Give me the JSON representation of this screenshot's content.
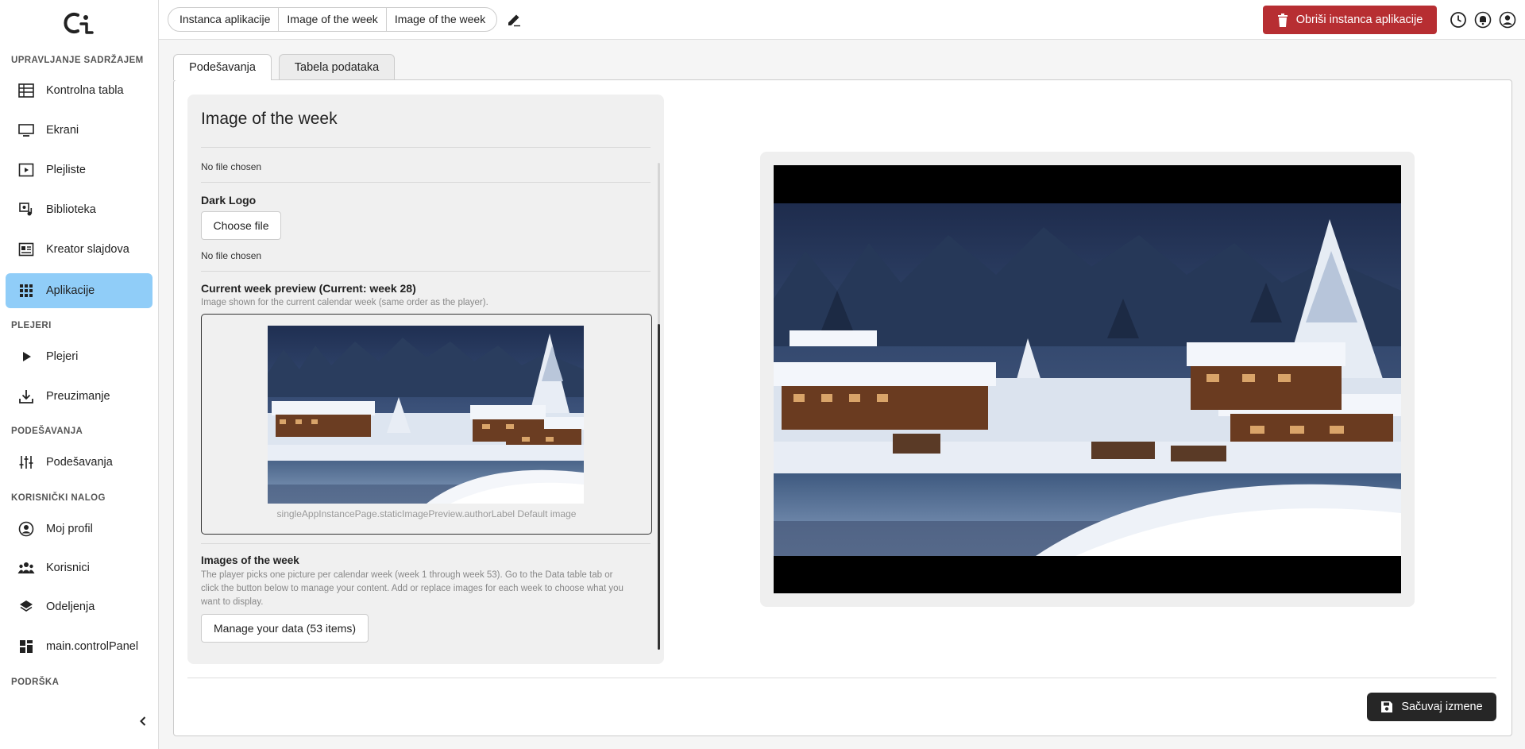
{
  "sidebar": {
    "sections": {
      "content": "UPRAVLJANJE SADRŽAJEM",
      "players": "PLEJERI",
      "settings": "PODEŠAVANJA",
      "account": "KORISNIČKI NALOG",
      "support": "PODRŠKA"
    },
    "items": [
      {
        "label": "Kontrolna tabla",
        "icon": "dashboard-table-icon"
      },
      {
        "label": "Ekrani",
        "icon": "monitor-icon"
      },
      {
        "label": "Plejliste",
        "icon": "playlist-icon"
      },
      {
        "label": "Biblioteka",
        "icon": "media-library-icon"
      },
      {
        "label": "Kreator slajdova",
        "icon": "slide-creator-icon"
      },
      {
        "label": "Aplikacije",
        "icon": "apps-grid-icon",
        "active": true
      },
      {
        "label": "Plejeri",
        "icon": "play-icon"
      },
      {
        "label": "Preuzimanje",
        "icon": "download-icon"
      },
      {
        "label": "Podešavanja",
        "icon": "sliders-icon"
      },
      {
        "label": "Moj profil",
        "icon": "account-circle-icon"
      },
      {
        "label": "Korisnici",
        "icon": "users-icon"
      },
      {
        "label": "Odeljenja",
        "icon": "layers-icon"
      },
      {
        "label": "main.controlPanel",
        "icon": "control-panel-icon"
      }
    ]
  },
  "topbar": {
    "breadcrumbs": [
      "Instanca aplikacije",
      "Image of the week",
      "Image of the week"
    ],
    "delete_label": "Obriši instanca aplikacije",
    "accent_delete": "#b72e32"
  },
  "tabs": [
    "Podešavanja",
    "Tabela podataka"
  ],
  "panel": {
    "title": "Image of the week",
    "logo_file_status": "No file chosen",
    "dark_logo_label": "Dark Logo",
    "choose_file": "Choose file",
    "dark_logo_file_status": "No file chosen",
    "preview_title": "Current week preview (Current: week 28)",
    "preview_hint": "Image shown for the current calendar week (same order as the player).",
    "preview_caption": "singleAppInstancePage.staticImagePreview.authorLabel Default image",
    "images_title": "Images of the week",
    "images_hint_1": "The player picks one picture per calendar week (week 1 through week 53). Go to the Data table tab or",
    "images_hint_2": "click the button below to manage your content. Add or replace images for each week to choose what you",
    "images_hint_3": "want to display.",
    "manage_button": "Manage your data (53 items)"
  },
  "footer": {
    "save_label": "Sačuvaj izmene"
  }
}
